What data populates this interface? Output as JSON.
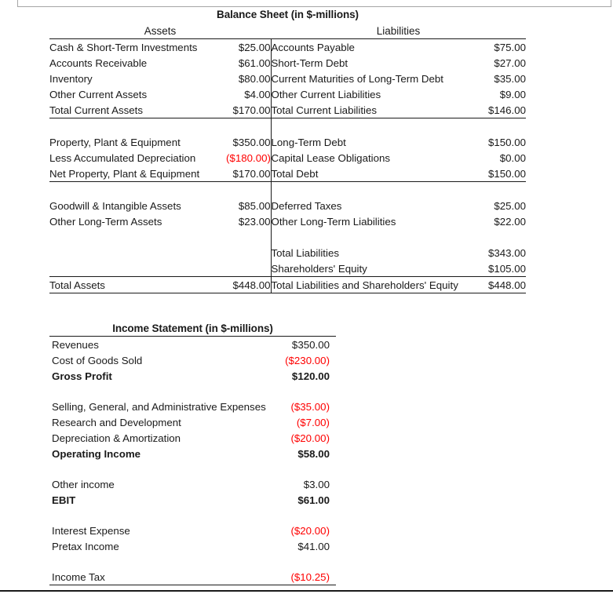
{
  "document": {
    "type": "spreadsheet-financial-statements",
    "negative_color": "#ff0000",
    "text_color": "#1a1a1a"
  },
  "balance_sheet": {
    "title": "Balance Sheet (in $-millions)",
    "assets_header": "Assets",
    "liabilities_header": "Liabilities",
    "rows": [
      {
        "asset_label": "Cash & Short-Term Investments",
        "asset_value": "$25.00",
        "liability_label": "Accounts Payable",
        "liability_value": "$75.00"
      },
      {
        "asset_label": "Accounts Receivable",
        "asset_value": "$61.00",
        "liability_label": "Short-Term Debt",
        "liability_value": "$27.00"
      },
      {
        "asset_label": "Inventory",
        "asset_value": "$80.00",
        "liability_label": "Current Maturities of Long-Term Debt",
        "liability_value": "$35.00"
      },
      {
        "asset_label": "Other Current Assets",
        "asset_value": "$4.00",
        "liability_label": "Other Current Liabilities",
        "liability_value": "$9.00"
      },
      {
        "asset_label": "Total Current Assets",
        "asset_value": "$170.00",
        "liability_label": "Total Current Liabilities",
        "liability_value": "$146.00"
      },
      {
        "asset_label": "Property, Plant & Equipment",
        "asset_value": "$350.00",
        "liability_label": "Long-Term Debt",
        "liability_value": "$150.00"
      },
      {
        "asset_label": "Less Accumulated Depreciation",
        "asset_value": "($180.00)",
        "liability_label": "Capital Lease Obligations",
        "liability_value": "$0.00"
      },
      {
        "asset_label": "Net Property, Plant & Equipment",
        "asset_value": "$170.00",
        "liability_label": "Total Debt",
        "liability_value": "$150.00"
      },
      {
        "asset_label": "Goodwill & Intangible Assets",
        "asset_value": "$85.00",
        "liability_label": "Deferred Taxes",
        "liability_value": "$25.00"
      },
      {
        "asset_label": "Other Long-Term Assets",
        "asset_value": "$23.00",
        "liability_label": "Other Long-Term Liabilities",
        "liability_value": "$22.00"
      },
      {
        "asset_label": "",
        "asset_value": "",
        "liability_label": "Total Liabilities",
        "liability_value": "$343.00"
      },
      {
        "asset_label": "",
        "asset_value": "",
        "liability_label": "Shareholders' Equity",
        "liability_value": "$105.00"
      },
      {
        "asset_label": "Total Assets",
        "asset_value": "$448.00",
        "liability_label": "Total Liabilities and Shareholders' Equity",
        "liability_value": "$448.00"
      }
    ]
  },
  "income_statement": {
    "title": "Income Statement (in $-millions)",
    "rows": [
      {
        "label": "Revenues",
        "value": "$350.00"
      },
      {
        "label": "Cost of Goods Sold",
        "value": "($230.00)"
      },
      {
        "label": "Gross Profit",
        "value": "$120.00"
      },
      {
        "label": "Selling, General, and Administrative Expenses",
        "value": "($35.00)"
      },
      {
        "label": "Research and Development",
        "value": "($7.00)"
      },
      {
        "label": "Depreciation & Amortization",
        "value": "($20.00)"
      },
      {
        "label": "Operating Income",
        "value": "$58.00"
      },
      {
        "label": "Other income",
        "value": "$3.00"
      },
      {
        "label": "EBIT",
        "value": "$61.00"
      },
      {
        "label": "Interest Expense",
        "value": "($20.00)"
      },
      {
        "label": "Pretax Income",
        "value": "$41.00"
      },
      {
        "label": "Income Tax",
        "value": "($10.25)"
      }
    ]
  }
}
